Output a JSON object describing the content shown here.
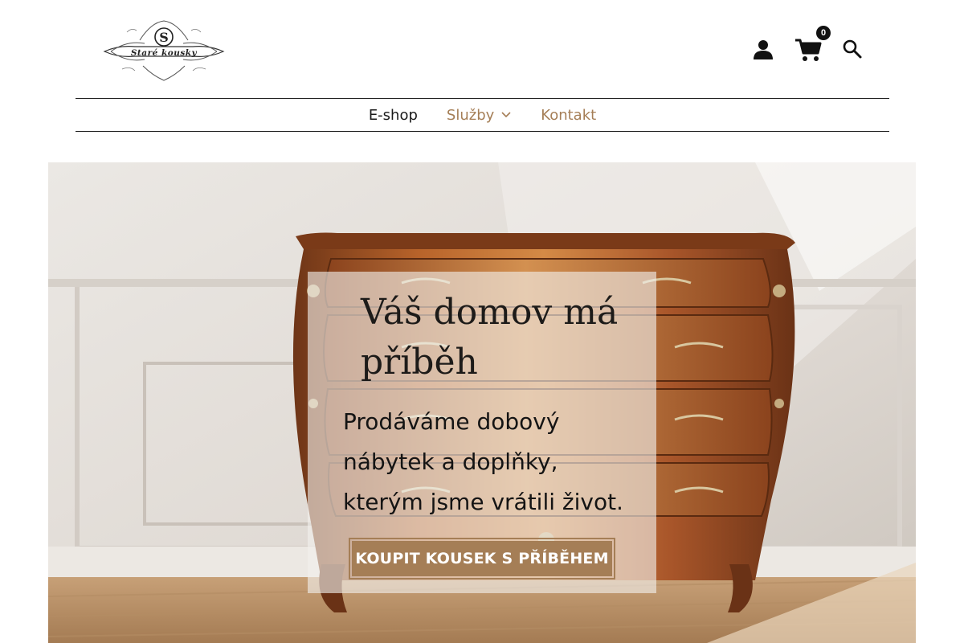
{
  "header": {
    "logo_text": "Staré kousky",
    "logo_monogram": "S",
    "icons": [
      "user-icon",
      "cart-icon",
      "search-icon"
    ],
    "cart_count": "0"
  },
  "nav": {
    "items": [
      {
        "label": "E-shop"
      },
      {
        "label": "Služby"
      },
      {
        "label": "Kontakt"
      }
    ]
  },
  "hero": {
    "title": "Váš domov má příběh",
    "subtitle": "Prodáváme dobový nábytek a doplňky, kterým jsme vrátili život.",
    "cta_label": "KOUPIT KOUSEK S PŘÍBĚHEM"
  },
  "colors": {
    "accent": "#a57e56",
    "text": "#1a1a1a",
    "badge": "#111111"
  }
}
